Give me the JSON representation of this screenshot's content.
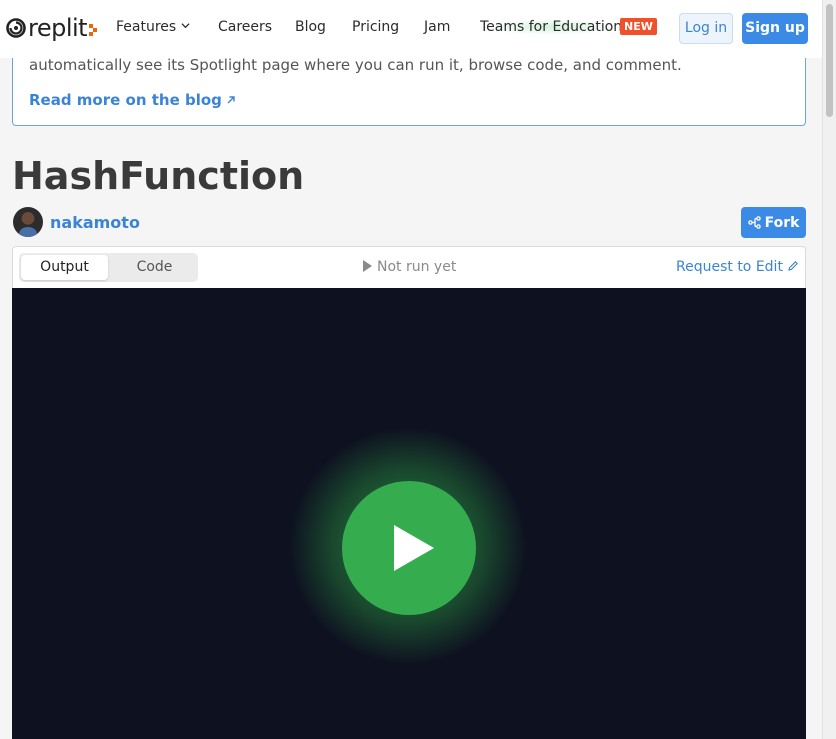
{
  "nav": {
    "logo_text": "replit",
    "items": [
      {
        "label": "Features"
      },
      {
        "label": "Careers"
      },
      {
        "label": "Blog"
      },
      {
        "label": "Pricing"
      },
      {
        "label": "Jam"
      },
      {
        "label": "Teams for Education"
      }
    ],
    "new_badge": "NEW",
    "login_label": "Log in",
    "signup_label": "Sign up"
  },
  "info": {
    "text": "automatically see its Spotlight page where you can run it, browse code, and comment.",
    "link_label": "Read more on the blog"
  },
  "repl": {
    "title": "HashFunction",
    "author": "nakamoto",
    "fork_label": "Fork"
  },
  "panel": {
    "tabs": [
      {
        "label": "Output"
      },
      {
        "label": "Code"
      }
    ],
    "active_tab": "Output",
    "run_status": "Not run yet",
    "request_edit_label": "Request to Edit"
  },
  "colors": {
    "accent": "#3b8be6",
    "new_badge": "#f0512b",
    "play": "#35ad4f",
    "output_bg": "#0e1120"
  },
  "icons": [
    "replit-logo-icon",
    "chevron-down-icon",
    "external-arrow-icon",
    "fork-icon",
    "play-icon",
    "pencil-icon"
  ]
}
